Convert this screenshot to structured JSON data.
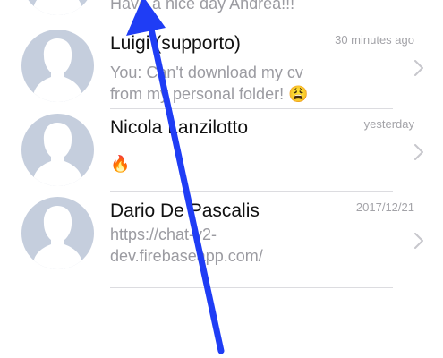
{
  "conversations": [
    {
      "name": "",
      "time": "",
      "preview": "Have a nice day Andrea!!!",
      "emoji": ""
    },
    {
      "name": "Luigi (supporto)",
      "time": "30 minutes ago",
      "preview": "You: Can't download my cv from my personal folder!",
      "emoji": "😩"
    },
    {
      "name": "Nicola Lanzilotto",
      "time": "yesterday",
      "preview": "",
      "emoji": "🔥"
    },
    {
      "name": "Dario De Pascalis",
      "time": "2017/12/21",
      "preview": "https://chat-v2-dev.firebaseapp.com/",
      "emoji": ""
    }
  ],
  "colors": {
    "avatar_bg": "#c5cedd",
    "avatar_silhouette": "#ffffff",
    "name_text": "#111111",
    "secondary_text": "#9b9ba1",
    "annotation_arrow": "#1f3df5"
  },
  "icons": {
    "avatar": "person-silhouette-icon",
    "disclosure": "chevron-right-icon",
    "annotation": "arrow-up-icon"
  }
}
